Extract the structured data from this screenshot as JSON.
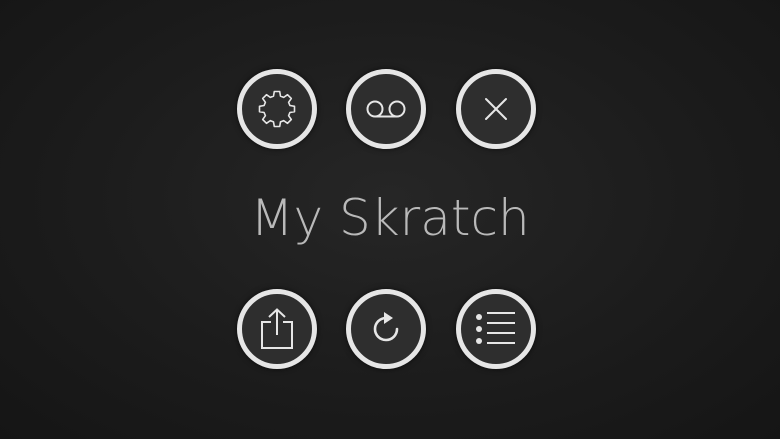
{
  "app": {
    "title": "My Skratch"
  },
  "buttons": {
    "top": [
      {
        "name": "settings",
        "icon": "gear-icon"
      },
      {
        "name": "voicemail",
        "icon": "voicemail-icon"
      },
      {
        "name": "close",
        "icon": "close-icon"
      }
    ],
    "bottom": [
      {
        "name": "share",
        "icon": "share-icon"
      },
      {
        "name": "refresh",
        "icon": "refresh-icon"
      },
      {
        "name": "list",
        "icon": "list-icon"
      }
    ]
  },
  "colors": {
    "background": "#1c1c1c",
    "button_fill": "#2e2e2e",
    "button_ring": "#e6e6e6",
    "icon": "#e6e6e6",
    "title": "#b9b9b9"
  }
}
